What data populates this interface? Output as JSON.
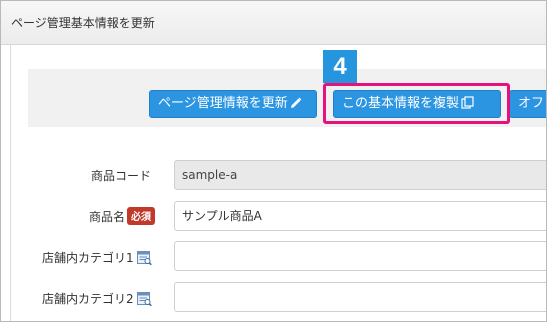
{
  "panel": {
    "title": "ページ管理基本情報を更新"
  },
  "step_badge": "4",
  "toolbar": {
    "update_label": "ページ管理情報を更新",
    "copy_label": "この基本情報を複製",
    "other_label": "オフ"
  },
  "form": {
    "product_code": {
      "label": "商品コード",
      "value": "sample-a"
    },
    "product_name": {
      "label": "商品名",
      "required_badge": "必須",
      "value": "サンプル商品A"
    },
    "category1": {
      "label": "店舗内カテゴリ1",
      "value": ""
    },
    "category2": {
      "label": "店舗内カテゴリ2",
      "value": ""
    }
  },
  "colors": {
    "button_blue": "#2b95e2",
    "highlight_pink": "#e4127a",
    "required_red": "#c0392b"
  }
}
